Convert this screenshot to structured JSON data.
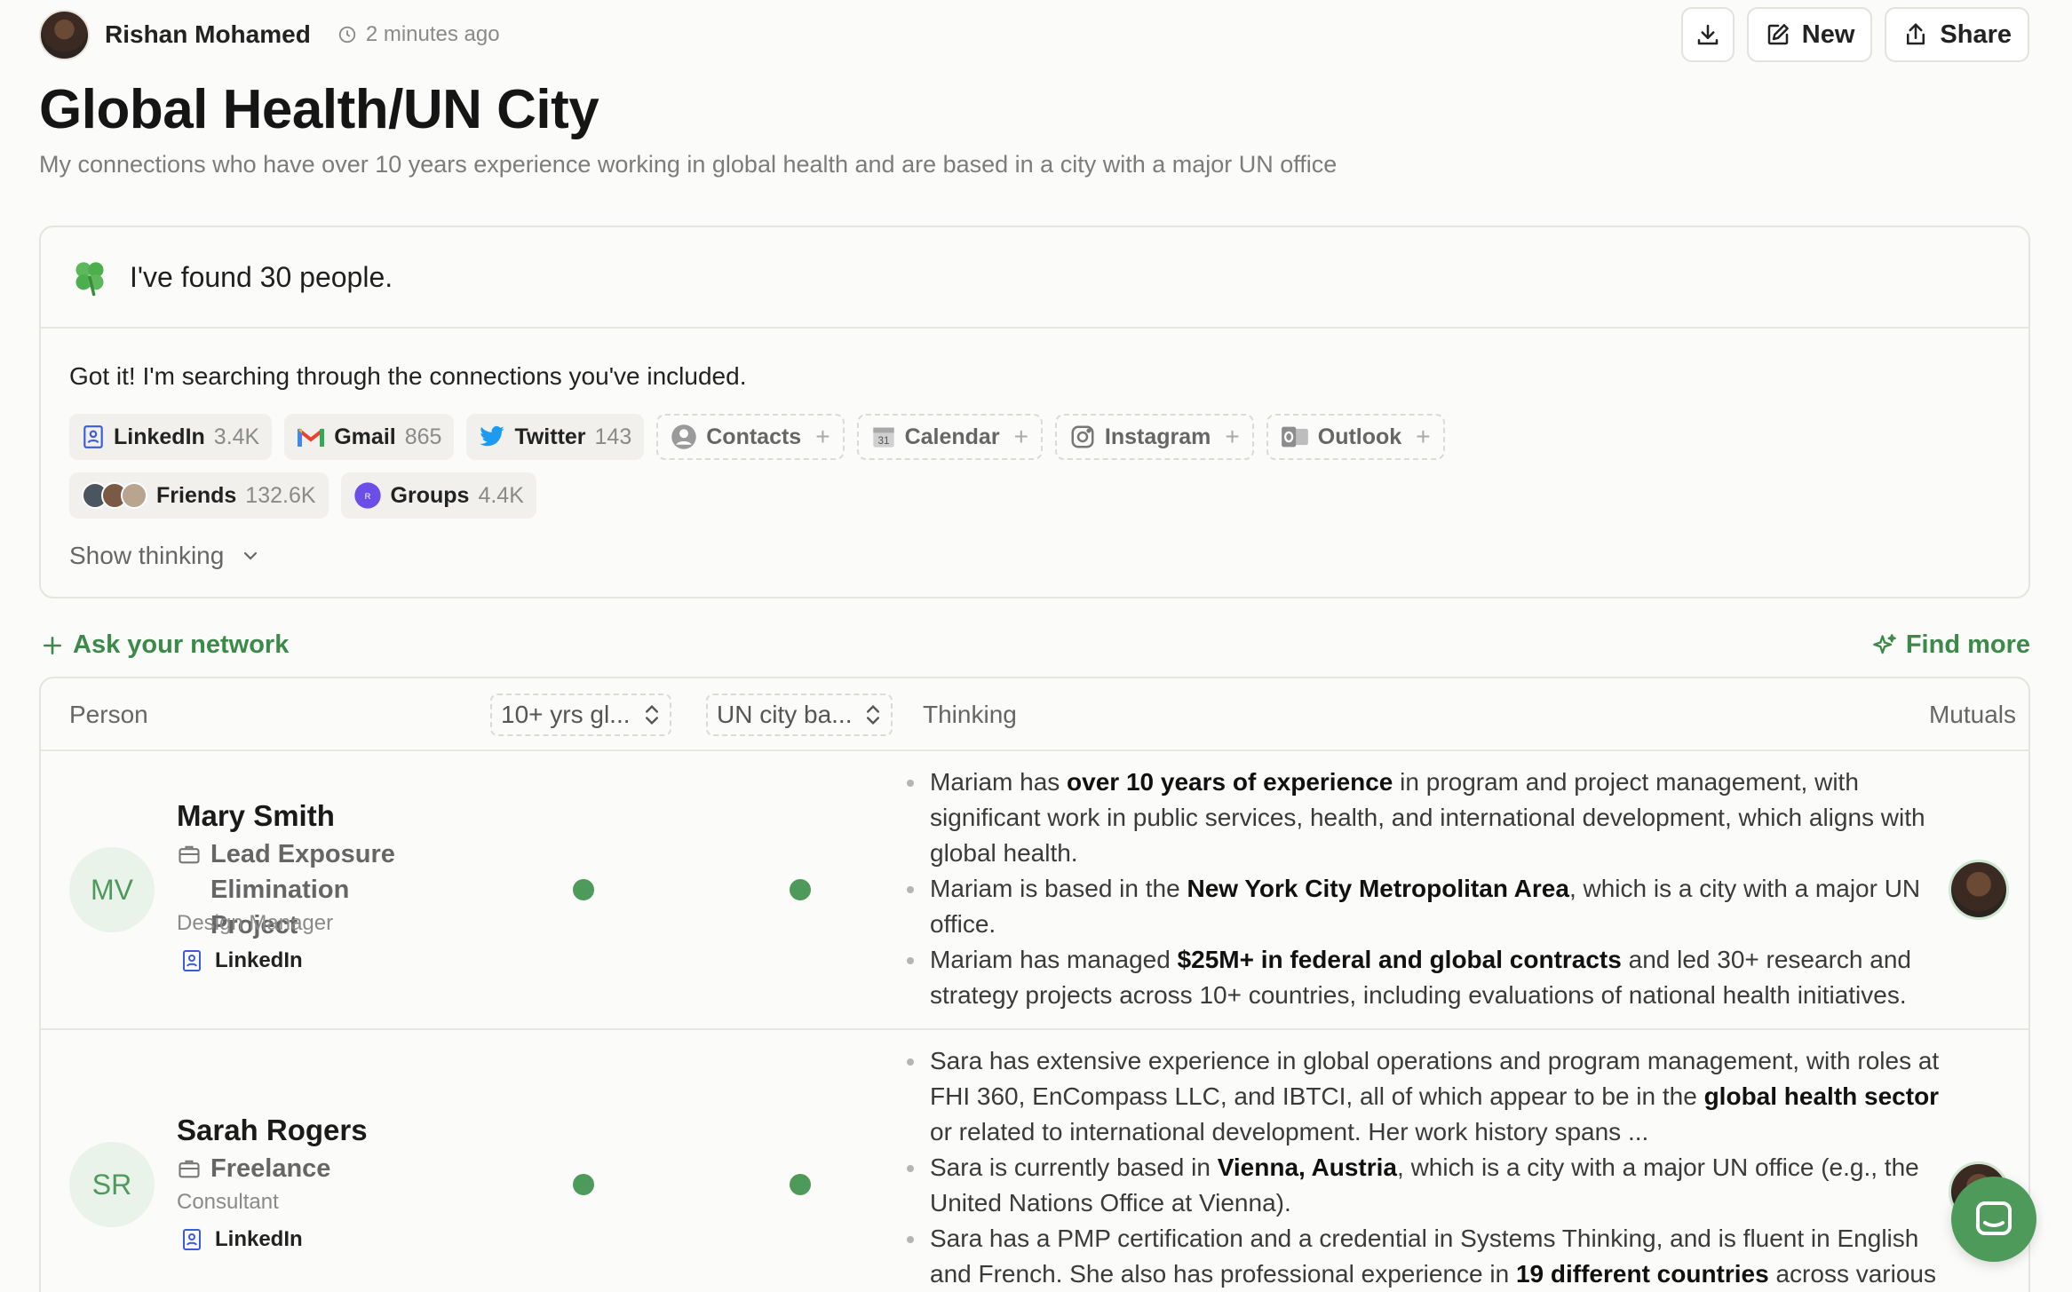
{
  "header": {
    "author": "Rishan Mohamed",
    "time": "2 minutes ago",
    "new_label": "New",
    "share_label": "Share"
  },
  "page": {
    "title": "Global Health/UN City",
    "subtitle": "My connections who have over 10 years experience working in global health and are based in a city with a major UN office"
  },
  "result": {
    "found": "I've found 30 people.",
    "intro": "Got it! I'm searching through the connections you've included.",
    "sources": [
      {
        "label": "LinkedIn",
        "count": "3.4K"
      },
      {
        "label": "Gmail",
        "count": "865"
      },
      {
        "label": "Twitter",
        "count": "143"
      },
      {
        "label": "Contacts"
      },
      {
        "label": "Calendar"
      },
      {
        "label": "Instagram"
      },
      {
        "label": "Outlook"
      },
      {
        "label": "Friends",
        "count": "132.6K"
      },
      {
        "label": "Groups",
        "count": "4.4K"
      }
    ],
    "show_thinking": "Show thinking"
  },
  "actions": {
    "ask": "Ask your network",
    "find_more": "Find more"
  },
  "table": {
    "headers": {
      "person": "Person",
      "col1": "10+ yrs gl...",
      "col2": "UN city ba...",
      "thinking": "Thinking",
      "mutuals": "Mutuals"
    },
    "rows": [
      {
        "initials": "MV",
        "name": "Mary Smith",
        "company": "Lead Exposure Elimination Project",
        "role": "Design Manager",
        "source": "LinkedIn",
        "thinking": [
          {
            "pre": "Mariam has ",
            "bold": "over 10 years of experience",
            "post": " in program and project management, with significant work in public services, health, and international development, which aligns with global health."
          },
          {
            "pre": "Mariam is based in the ",
            "bold": "New York City Metropolitan Area",
            "post": ", which is a city with a major UN office."
          },
          {
            "pre": "Mariam has managed ",
            "bold": "$25M+ in federal and global contracts",
            "post": " and led 30+ research and strategy projects across 10+ countries, including evaluations of national health initiatives."
          }
        ]
      },
      {
        "initials": "SR",
        "name": "Sarah Rogers",
        "company": "Freelance",
        "role": "Consultant",
        "source": "LinkedIn",
        "thinking": [
          {
            "pre": "Sara has extensive experience in global operations and program management, with roles at FHI 360, EnCompass LLC, and IBTCI, all of which appear to be in the ",
            "bold": "global health sector",
            "post": " or related to international development. Her work history spans ..."
          },
          {
            "pre": "Sara is currently based in ",
            "bold": "Vienna, Austria",
            "post": ", which is a city with a major UN office (e.g., the United Nations Office at Vienna)."
          },
          {
            "pre": "Sara has a PMP certification and a credential in Systems Thinking, and is fluent in English and French. She also has professional experience in ",
            "bold": "19 different countries",
            "post": " across various"
          }
        ]
      }
    ]
  },
  "colors": {
    "accent": "#4e9a5a",
    "link_green": "#3b8a4a",
    "groups_purple": "#6b4ee6"
  }
}
